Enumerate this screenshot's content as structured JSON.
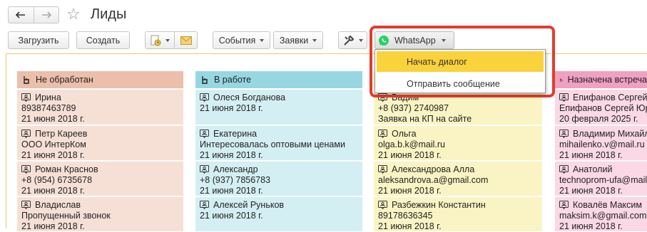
{
  "title": "Лиды",
  "toolbar": {
    "load": "Загрузить",
    "create": "Создать",
    "events": "События",
    "requests": "Заявки",
    "whatsapp": "WhatsApp"
  },
  "whatsapp_menu": {
    "items": [
      "Начать диалог",
      "Отправить сообщение"
    ],
    "active_index": 0
  },
  "colors": {
    "accent_red": "#e23c2e",
    "menu_highlight": "#f9d23c",
    "whatsapp_green": "#25d366"
  },
  "columns": [
    {
      "title": "Не обработан",
      "header_color": "#ebbfaa",
      "card_color": "#f6e0d6",
      "cards": [
        {
          "name": "Ирина",
          "line2": "89387463789",
          "line3": "21 июня 2018 г."
        },
        {
          "name": "Петр Кареев",
          "line2": "ООО ИнтерКом",
          "line3": "21 июня 2018 г."
        },
        {
          "name": "Роман Краснов",
          "line2": "+8 (954) 6735678",
          "line3": "21 июня 2018 г."
        },
        {
          "name": "Владислав",
          "line2": "Пропущенный звонок",
          "line3": "21 июня 2018 г."
        }
      ]
    },
    {
      "title": "В работе",
      "header_color": "#96d7e2",
      "card_color": "#d4eff3",
      "cards": [
        {
          "name": "Олеся Богданова",
          "line2": "21 июня 2018 г.",
          "line3": ""
        },
        {
          "name": "Екатерина",
          "line2": "Интересовалась оптовыми ценами",
          "line3": "21 июня 2018 г."
        },
        {
          "name": "Александр",
          "line2": "+8 (937) 7856783",
          "line3": "21 июня 2018 г."
        },
        {
          "name": "Алексей Руньков",
          "line2": "21 июня 2018 г.",
          "line3": ""
        }
      ]
    },
    {
      "title": "",
      "header_color": "#f1e889",
      "card_color": "#faf4c4",
      "cards": [
        {
          "name": "Вадим",
          "line2": "+8 (937) 2740987",
          "line3": "Заявка на КП на сайте"
        },
        {
          "name": "Ольга",
          "line2": "olga.b.k@mail.ru",
          "line3": "21 июня 2018 г."
        },
        {
          "name": "Александрова Алла",
          "line2": "aleksandrova.a@gmail.com",
          "line3": "21 июня 2018 г."
        },
        {
          "name": "Разбежкин Константин",
          "line2": "89178636345",
          "line3": "21 июня 2018 г."
        }
      ]
    },
    {
      "title": "Назначена встреча",
      "header_color": "#f0a0c0",
      "card_color": "#fad8e6",
      "cards": [
        {
          "name": "Епифанов Сергей",
          "line2": "Епифанов Сергей Юрьевич",
          "line3": "20 февраля 2025 г."
        },
        {
          "name": "Владимир Михайленко",
          "line2": "mihailenko.v@mail.ru",
          "line3": "21 июня 2018 г."
        },
        {
          "name": "Анатолий",
          "line2": "technoprom-ufa@mail.ru",
          "line3": "21 июня 2018 г."
        },
        {
          "name": "Ковалёв Максим",
          "line2": "maksim.k@gmail.com",
          "line3": "21 июня 2018 г."
        }
      ]
    }
  ]
}
